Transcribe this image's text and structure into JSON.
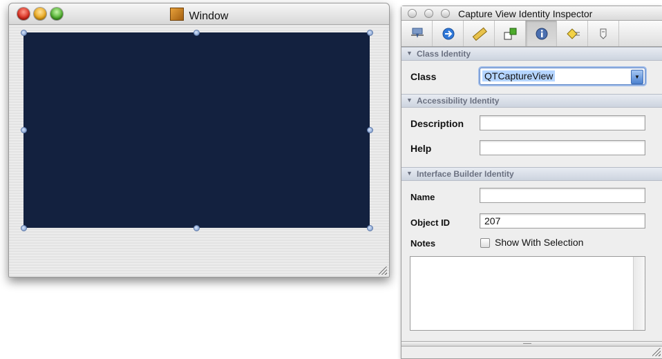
{
  "window": {
    "title": "Window",
    "canvas_color": "#13213f"
  },
  "inspector": {
    "title": "Capture View Identity Inspector",
    "tabs": [
      {
        "name": "attributes",
        "icon": "attributes-icon"
      },
      {
        "name": "effects",
        "icon": "arrow-circle-icon"
      },
      {
        "name": "size",
        "icon": "ruler-icon"
      },
      {
        "name": "connections",
        "icon": "connections-icon"
      },
      {
        "name": "identity",
        "icon": "info-icon",
        "active": true
      },
      {
        "name": "bindings",
        "icon": "bindings-icon"
      },
      {
        "name": "applescript",
        "icon": "script-icon"
      }
    ],
    "class_identity": {
      "header": "Class Identity",
      "class_label": "Class",
      "class_value": "QTCaptureView"
    },
    "accessibility_identity": {
      "header": "Accessibility Identity",
      "description_label": "Description",
      "description_value": "",
      "help_label": "Help",
      "help_value": ""
    },
    "ib_identity": {
      "header": "Interface Builder Identity",
      "name_label": "Name",
      "name_value": "",
      "object_id_label": "Object ID",
      "object_id_value": "207",
      "notes_label": "Notes",
      "show_with_selection_label": "Show With Selection",
      "show_with_selection_checked": false,
      "notes_value": ""
    }
  }
}
